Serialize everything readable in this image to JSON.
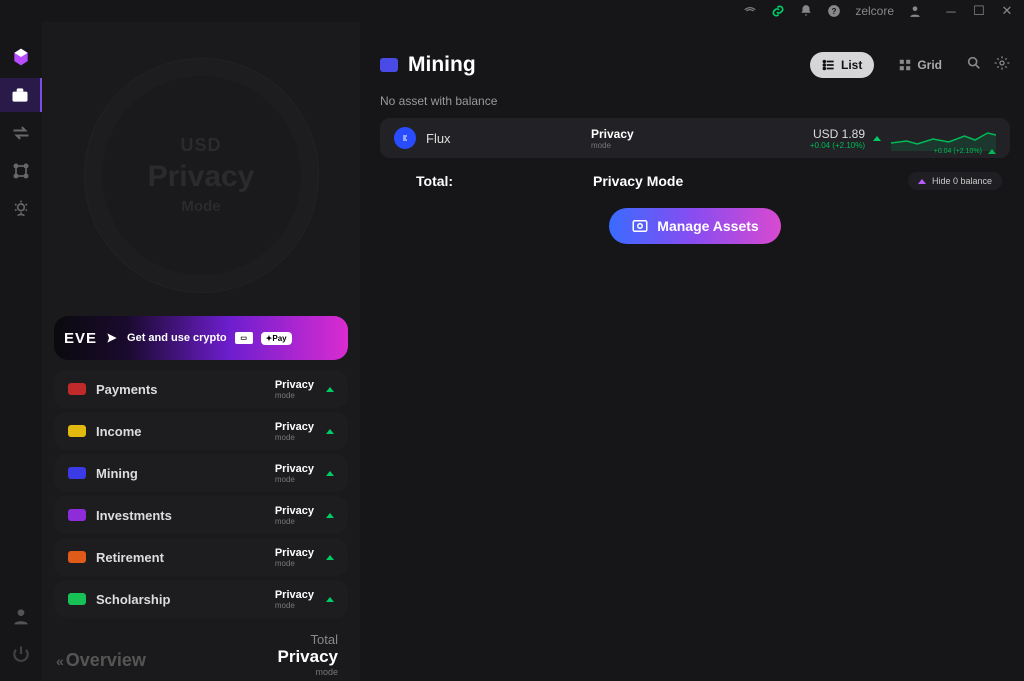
{
  "titlebar": {
    "user": "zelcore"
  },
  "rail": {
    "items": [
      "logo",
      "portfolio",
      "swap",
      "apps",
      "settings"
    ]
  },
  "ring": {
    "l1": "USD",
    "l2": "Privacy",
    "l3": "Mode"
  },
  "eve": {
    "brand": "EVE",
    "text": "Get and use crypto",
    "badge": "✦Pay"
  },
  "categories": [
    {
      "name": "Payments",
      "color": "#c02a2a",
      "privacy": "Privacy",
      "mode": "mode"
    },
    {
      "name": "Income",
      "color": "#e2b90f",
      "privacy": "Privacy",
      "mode": "mode"
    },
    {
      "name": "Mining",
      "color": "#3a3ae6",
      "privacy": "Privacy",
      "mode": "mode"
    },
    {
      "name": "Investments",
      "color": "#8e2cd9",
      "privacy": "Privacy",
      "mode": "mode"
    },
    {
      "name": "Retirement",
      "color": "#e05a1a",
      "privacy": "Privacy",
      "mode": "mode"
    },
    {
      "name": "Scholarship",
      "color": "#18c155",
      "privacy": "Privacy",
      "mode": "mode"
    }
  ],
  "sideTotal": {
    "label": "Total",
    "value": "Privacy",
    "sub": "mode"
  },
  "overview": "Overview",
  "main": {
    "title": "Mining",
    "listLabel": "List",
    "gridLabel": "Grid",
    "noasset": "No asset with balance",
    "asset": {
      "name": "Flux",
      "privacy": "Privacy",
      "mode": "mode",
      "usd": "USD 1.89",
      "delta": "+0.04 (+2.10%)",
      "spark": "+0.04 (+2.10%)"
    },
    "totalLabel": "Total:",
    "privacyMode": "Privacy Mode",
    "hideZero": "Hide 0 balance",
    "manage": "Manage Assets"
  }
}
